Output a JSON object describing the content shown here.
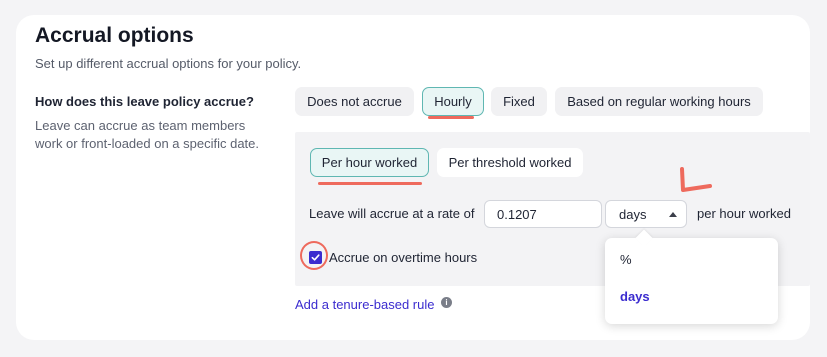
{
  "section": {
    "title": "Accrual options",
    "subtitle": "Set up different accrual options for your policy."
  },
  "question": {
    "title": "How does this leave policy accrue?",
    "help": "Leave can accrue as team members work or front-loaded on a specific date."
  },
  "accrual_types": [
    {
      "label": "Does not accrue",
      "selected": false
    },
    {
      "label": "Hourly",
      "selected": true
    },
    {
      "label": "Fixed",
      "selected": false
    },
    {
      "label": "Based on regular working hours",
      "selected": false
    }
  ],
  "hourly_modes": [
    {
      "label": "Per hour worked",
      "selected": true
    },
    {
      "label": "Per threshold worked",
      "selected": false
    }
  ],
  "rate": {
    "label": "Leave will accrue at a rate of",
    "value": "0.1207",
    "unit": "days",
    "suffix": "per hour worked"
  },
  "unit_options": [
    {
      "label": "%",
      "selected": false
    },
    {
      "label": "days",
      "selected": true
    }
  ],
  "overtime": {
    "label": "Accrue on overtime hours",
    "checked": true
  },
  "tenure_link": "Add a tenure-based rule",
  "colors": {
    "accent": "#3b2ccf",
    "selected_border": "#5fb7b2",
    "annotation": "#ee6a5d"
  }
}
